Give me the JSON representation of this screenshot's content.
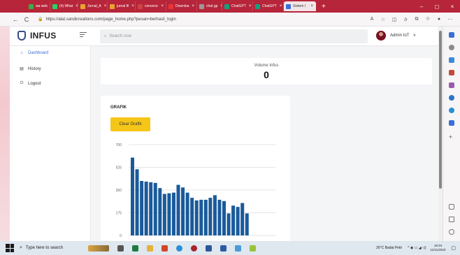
{
  "browser": {
    "tabs": [
      {
        "title": "wa web",
        "color": "#2fb344"
      },
      {
        "title": "(4) What",
        "color": "#25d366"
      },
      {
        "title": "Jurnal_A",
        "color": "#e7a52c"
      },
      {
        "title": "jurnal fil",
        "color": "#e7a52c"
      },
      {
        "title": "conversi",
        "color": "#c44"
      },
      {
        "title": "Downloa",
        "color": "#e33"
      },
      {
        "title": "chat gp",
        "color": "#999"
      },
      {
        "title": "ChatGPT",
        "color": "#10a37f"
      },
      {
        "title": "ChatGPT",
        "color": "#10a37f"
      },
      {
        "title": "Sistem I",
        "color": "#3a6ed8"
      }
    ],
    "tab_close": "×",
    "new_tab": "+",
    "window_controls": {
      "minimize": "–",
      "maximize": "◻",
      "close": "×"
    },
    "url": "https://alat.sandicreations.com/page_home.php?pesan=berhasil_login",
    "nav": {
      "back": "←",
      "refresh": "C"
    }
  },
  "app": {
    "logo_text": "INFUS",
    "search_placeholder": "Search now",
    "user_name": "Admin IoT",
    "user_caret": "v"
  },
  "sidebar": {
    "items": [
      {
        "label": "Dashboard",
        "icon": "home-icon",
        "glyph": "⌂",
        "active": true
      },
      {
        "label": "History",
        "icon": "database-icon",
        "glyph": "▤",
        "active": false
      },
      {
        "label": "Logout",
        "icon": "power-icon",
        "glyph": "⏻",
        "active": false
      }
    ]
  },
  "volume": {
    "label": "Volume Infus",
    "value": "0"
  },
  "grafik": {
    "title": "GRAFIK",
    "clear_button": "Clear Grafik"
  },
  "chart_data": {
    "type": "bar",
    "yticks": [
      0,
      175,
      350,
      525,
      700
    ],
    "ylim": [
      0,
      700
    ],
    "grid": true,
    "bar_color": "#1a5a9a",
    "values": [
      600,
      510,
      420,
      415,
      410,
      405,
      365,
      320,
      325,
      330,
      390,
      370,
      330,
      290,
      270,
      275,
      275,
      290,
      310,
      275,
      265,
      170,
      230,
      220,
      250,
      170
    ]
  },
  "taskbar": {
    "search_placeholder": "Type here to search",
    "weather": "26°C Badai Petir",
    "time": "18:34",
    "date": "11/11/2023"
  }
}
